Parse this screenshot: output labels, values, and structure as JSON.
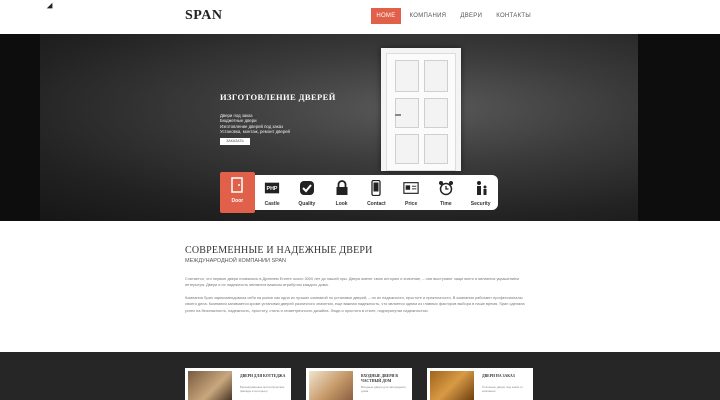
{
  "header": {
    "logo": "SPAN",
    "nav": [
      "HOME",
      "КОМПАНИЯ",
      "ДВЕРИ",
      "КОНТАКТЫ"
    ]
  },
  "hero": {
    "title": "ИЗГОТОВЛЕНИЕ ДВЕРЕЙ",
    "list": [
      "Двери под заказ",
      "Бюджетные двери",
      "Изготовление дверей под заказ",
      "Установка, монтаж, ремонт дверей"
    ],
    "button": "ЗАКАЗАТЬ"
  },
  "icons": [
    {
      "label": "Door",
      "icon": "door-icon"
    },
    {
      "label": "Castle",
      "icon": "php-icon"
    },
    {
      "label": "Quality",
      "icon": "check-icon"
    },
    {
      "label": "Look",
      "icon": "lock-icon"
    },
    {
      "label": "Contact",
      "icon": "phone-icon"
    },
    {
      "label": "Price",
      "icon": "price-tag-icon"
    },
    {
      "label": "Time",
      "icon": "alarm-clock-icon"
    },
    {
      "label": "Security",
      "icon": "people-icon"
    }
  ],
  "about": {
    "title": "СОВРЕМЕННЫЕ И НАДЕЖНЫЕ ДВЕРИ",
    "subtitle": "МЕЖДУНАРОДНОЙ КОМПАНИИ SPAN",
    "p1": "Считается, что первые двери появились в Древнем Египте около 3000 лет до нашей эры. Двери имеют свою историю и значение, – они выступают чаще всего и являются украшением интерьера. Двери и их надежность являются важным атрибутом каждого дома.",
    "p2": "Компания Span зарекомендовала себя на рынке как одна из лучших компаний по установке дверей, – по их надежности, простоте и практичности. В компании работают профессионалы своего дела. Компания занимается кроме установки дверей различного значения, еще важная надежность, что является одним из главных факторов выбора в наше время. Span сделала успех на безопасность, надежность, простоту, стиль и геометричность дизайна. Люди и простота в стиле, подчеркнутая надежностью."
  },
  "cards": [
    {
      "title": "ДВЕРИ ДЛЯ КОТТЕДЖА",
      "text": "Бронированные металлические фасады в интерьер"
    },
    {
      "title": "ВХОДНЫЕ ДВЕРИ В ЧАСТНЫЙ ДОМ",
      "text": "Входные двери для загородного дома"
    },
    {
      "title": "ДВЕРИ НА ЗАКАЗ",
      "text": "Стальные двери под заказ от компании"
    }
  ],
  "colors": {
    "accent": "#e0604a",
    "dark": "#262626"
  }
}
